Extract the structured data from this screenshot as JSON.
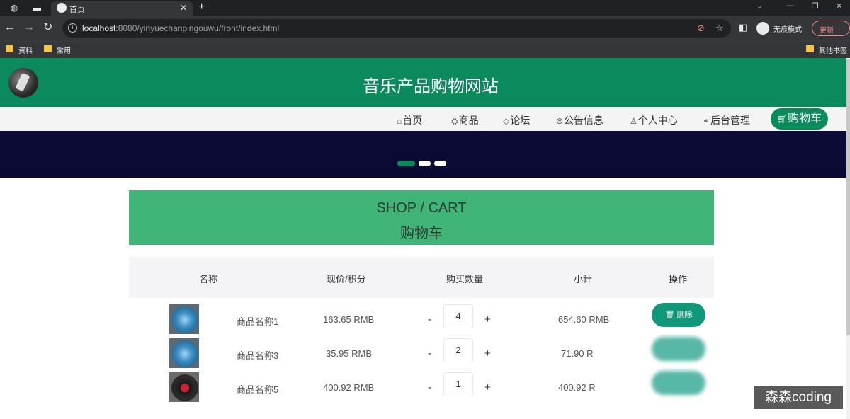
{
  "browser": {
    "tab_title": "首页",
    "url_host": "localhost",
    "url_rest": ":8080/yinyuechanpingouwu/front/index.html",
    "incognito_label": "无痕模式",
    "update_label": "更新",
    "bookmarks": [
      "资料",
      "常用",
      "其他书签"
    ]
  },
  "site": {
    "title": "音乐产品购物网站",
    "nav": [
      {
        "label": "首页",
        "icon": "home-icon"
      },
      {
        "label": "商品",
        "icon": "goods-icon"
      },
      {
        "label": "论坛",
        "icon": "tag-icon"
      },
      {
        "label": "公告信息",
        "icon": "notice-icon"
      },
      {
        "label": "个人中心",
        "icon": "user-icon"
      },
      {
        "label": "后台管理",
        "icon": "link-icon"
      }
    ],
    "cart_label": "购物车",
    "carousel_active_index": 0
  },
  "cart": {
    "heading_en": "SHOP / CART",
    "heading_zh": "购物车",
    "columns": [
      "名称",
      "现价/积分",
      "购买数量",
      "小计",
      "操作"
    ],
    "items": [
      {
        "name": "商品名称1",
        "price": "163.65 RMB",
        "qty": "4",
        "subtotal": "654.60 RMB",
        "action": "删除"
      },
      {
        "name": "商品名称3",
        "price": "35.95 RMB",
        "qty": "2",
        "subtotal": "71.90 R",
        "action": ""
      },
      {
        "name": "商品名称5",
        "price": "400.92 RMB",
        "qty": "1",
        "subtotal": "400.92 R",
        "action": ""
      }
    ],
    "minus": "-",
    "plus": "+"
  },
  "watermark": "森森coding",
  "colors": {
    "brand_green": "#0b8a5e",
    "cart_header_green": "#40b577",
    "delete_button": "#11977a"
  }
}
